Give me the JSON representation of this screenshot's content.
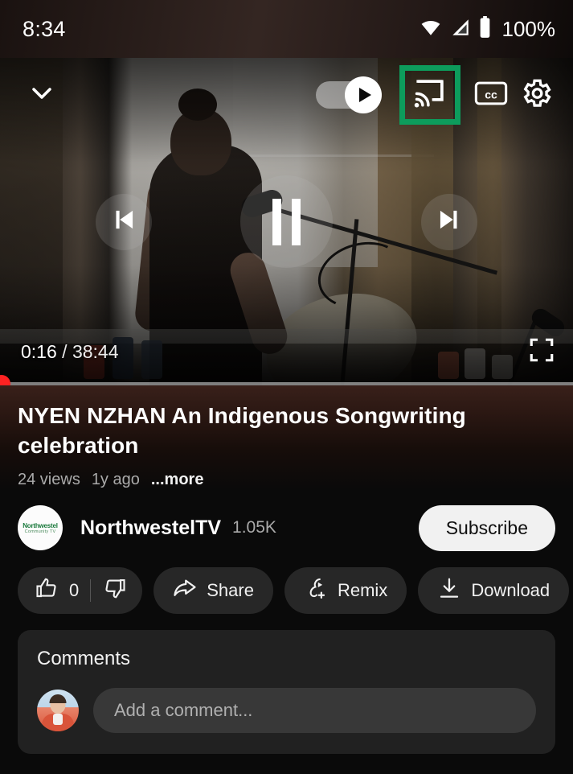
{
  "status_bar": {
    "time": "8:34",
    "battery_percent": "100%",
    "icons": [
      "wifi-icon",
      "cellular-signal-icon",
      "battery-icon"
    ]
  },
  "player": {
    "collapse_icon": "chevron-down-icon",
    "autoplay": {
      "name": "autoplay-toggle",
      "state": "on",
      "knob_icon": "play-icon"
    },
    "cast_button": {
      "icon": "cast-icon",
      "highlighted": true,
      "highlight_color": "#0d9c5c"
    },
    "captions_button": {
      "icon": "closed-captions-icon",
      "label": "cc"
    },
    "settings_button": {
      "icon": "gear-icon"
    },
    "transport": {
      "previous_icon": "skip-previous-icon",
      "pause_icon": "pause-icon",
      "next_icon": "skip-next-icon"
    },
    "current_time": "0:16",
    "time_separator": "/",
    "total_time": "38:44",
    "fullscreen_icon": "fullscreen-icon",
    "progress_percent": 0.7
  },
  "video": {
    "title": "NYEN NZHAN An Indigenous Songwriting celebration",
    "views": "24 views",
    "age": "1y ago",
    "more_label": "...more"
  },
  "channel": {
    "avatar_logo_line1": "Northwestel",
    "avatar_logo_line2": "Community TV",
    "name": "NorthwestelTV",
    "subscribers": "1.05K",
    "subscribe_label": "Subscribe"
  },
  "actions": [
    {
      "name": "like-button",
      "icon": "thumbs-up-icon",
      "label": "0"
    },
    {
      "name": "dislike-button",
      "icon": "thumbs-down-icon",
      "label": ""
    },
    {
      "name": "share-button",
      "icon": "share-icon",
      "label": "Share"
    },
    {
      "name": "remix-button",
      "icon": "remix-icon",
      "label": "Remix"
    },
    {
      "name": "download-button",
      "icon": "download-icon",
      "label": "Download"
    }
  ],
  "comments": {
    "title": "Comments",
    "input_placeholder": "Add a comment...",
    "input_value": ""
  }
}
